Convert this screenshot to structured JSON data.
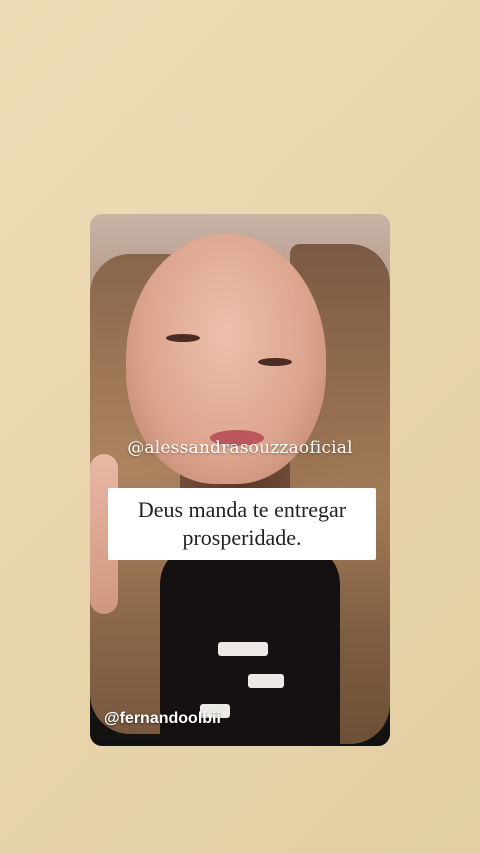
{
  "story": {
    "overlay_handle": "@alessandrasouzzaoficial",
    "caption": "Deus manda te entregar prosperidade.",
    "author_handle": "@fernandoolbii"
  }
}
